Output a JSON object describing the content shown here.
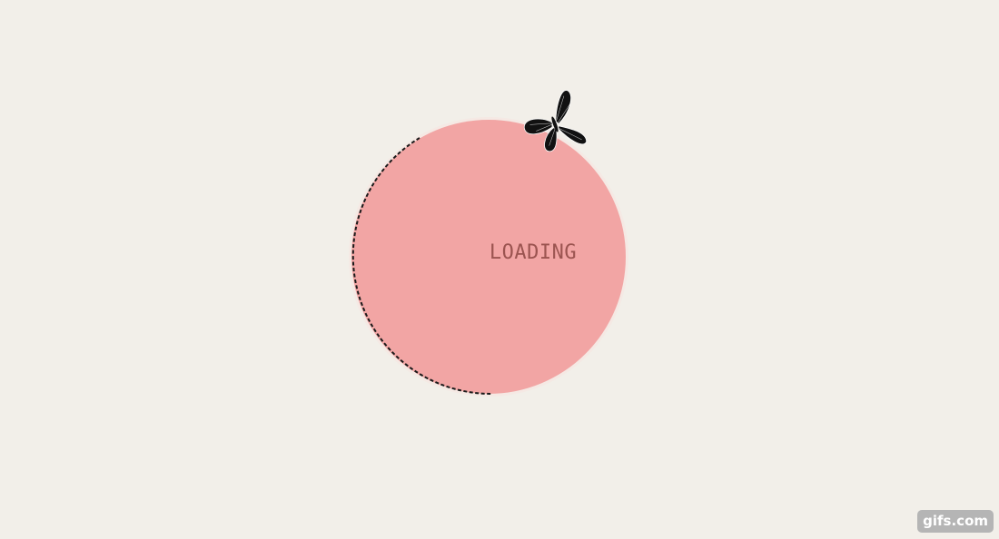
{
  "loader": {
    "label": "LOADING",
    "circle_color": "#f2a5a4",
    "label_color": "#9b5450",
    "background_color": "#f2efe9",
    "trail_color": "#1a1a1a"
  },
  "butterfly": {
    "icon": "butterfly-icon",
    "color": "#111111"
  },
  "watermark": {
    "text": "gifs.com",
    "color": "#b5b5b5"
  }
}
